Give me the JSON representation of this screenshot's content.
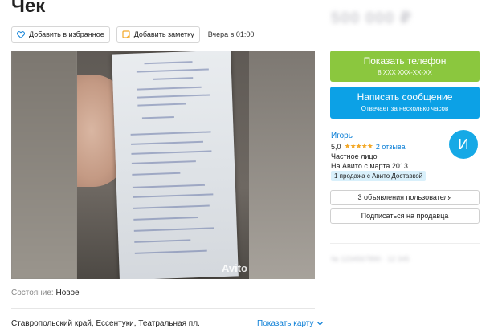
{
  "title": "Чек",
  "price": "500 000 ₽",
  "actions": {
    "favorite_label": "Добавить в избранное",
    "note_label": "Добавить заметку",
    "date": "Вчера в 01:00"
  },
  "photo": {
    "watermark": "Avito"
  },
  "details": {
    "condition_label": "Состояние:",
    "condition_value": "Новое",
    "address": "Ставропольский край, Ессентуки, Театральная пл.",
    "map_link": "Показать карту"
  },
  "contact": {
    "phone_label": "Показать телефон",
    "phone_masked": "8 XXX XXX-XX-XX",
    "message_label": "Написать сообщение",
    "message_sub": "Отвечает за несколько часов"
  },
  "seller": {
    "name": "Игорь",
    "rating": "5,0",
    "stars": "★★★★★",
    "reviews": "2 отзыва",
    "type": "Частное лицо",
    "since": "На Авито с марта 2013",
    "badge": "1 продажа с Авито Доставкой",
    "avatar_letter": "И",
    "ads_button": "3 объявления пользователя",
    "subscribe_button": "Подписаться на продавца"
  },
  "listing_id": "№ 1234567890 · 12 345",
  "colors": {
    "phone_button": "#8bc73e",
    "message_button": "#0ca1e6",
    "link": "#0a7ed6",
    "avatar": "#16a9e6",
    "badge_bg": "#d9f0fb"
  },
  "icons": [
    "heart-icon",
    "note-icon",
    "chevron-down-icon"
  ]
}
